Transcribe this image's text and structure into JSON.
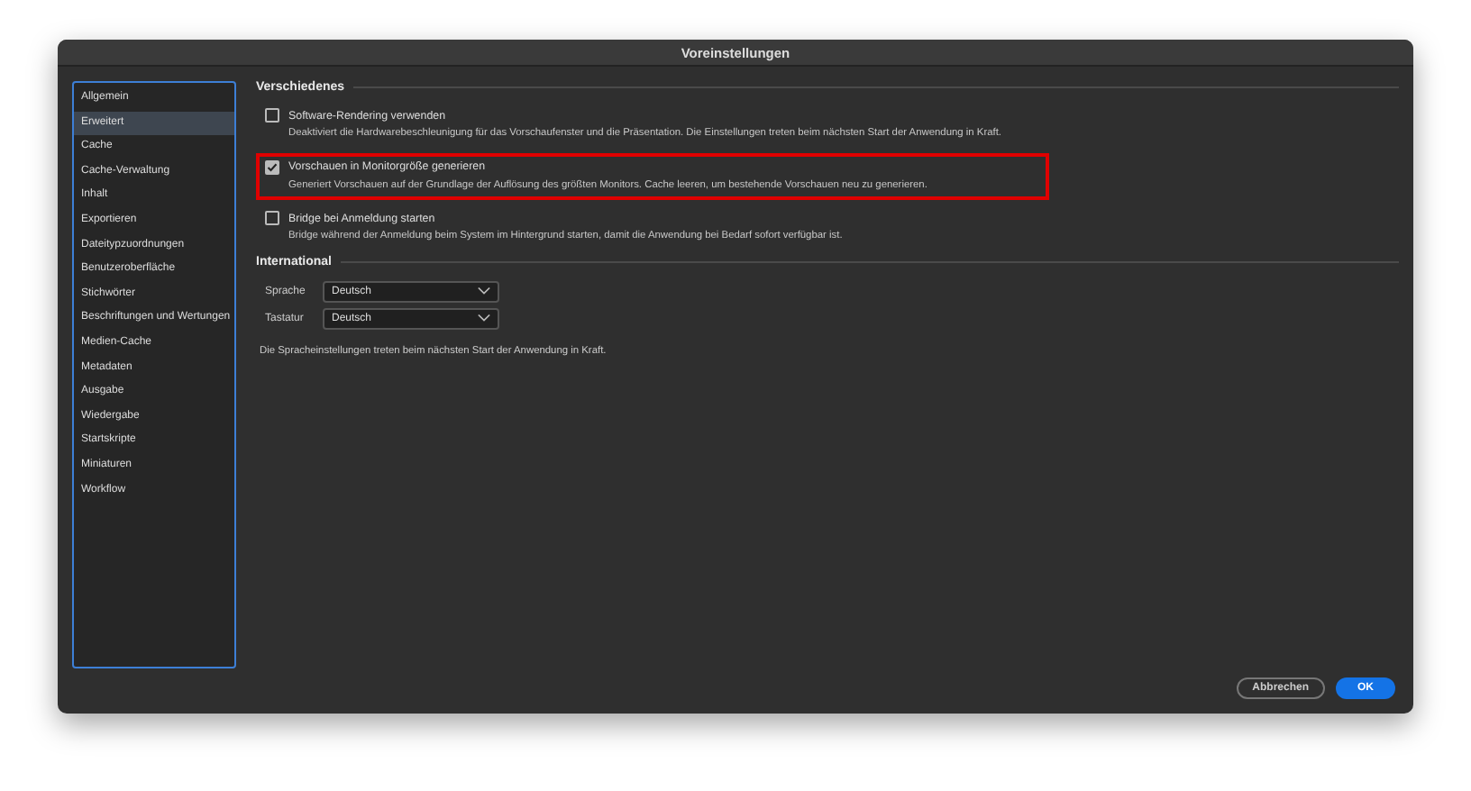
{
  "window": {
    "title": "Voreinstellungen"
  },
  "sidebar": {
    "items": [
      {
        "label": "Allgemein",
        "selected": false
      },
      {
        "label": "Erweitert",
        "selected": true
      },
      {
        "label": "Cache",
        "selected": false
      },
      {
        "label": "Cache-Verwaltung",
        "selected": false
      },
      {
        "label": "Inhalt",
        "selected": false
      },
      {
        "label": "Exportieren",
        "selected": false
      },
      {
        "label": "Dateitypzuordnungen",
        "selected": false
      },
      {
        "label": "Benutzeroberfläche",
        "selected": false
      },
      {
        "label": "Stichwörter",
        "selected": false
      },
      {
        "label": "Beschriftungen und Wertungen",
        "selected": false
      },
      {
        "label": "Medien-Cache",
        "selected": false
      },
      {
        "label": "Metadaten",
        "selected": false
      },
      {
        "label": "Ausgabe",
        "selected": false
      },
      {
        "label": "Wiedergabe",
        "selected": false
      },
      {
        "label": "Startskripte",
        "selected": false
      },
      {
        "label": "Miniaturen",
        "selected": false
      },
      {
        "label": "Workflow",
        "selected": false
      }
    ]
  },
  "sections": [
    {
      "title": "Verschiedenes",
      "options": [
        {
          "label": "Software-Rendering verwenden",
          "checked": false,
          "highlighted": false,
          "description": "Deaktiviert die Hardwarebeschleunigung für das Vorschaufenster und die Präsentation. Die Einstellungen treten beim nächsten Start der Anwendung in Kraft."
        },
        {
          "label": "Vorschauen in Monitorgröße generieren",
          "checked": true,
          "highlighted": true,
          "description": "Generiert Vorschauen auf der Grundlage der Auflösung des größten Monitors.  Cache leeren, um bestehende Vorschauen neu zu generieren."
        },
        {
          "label": "Bridge bei Anmeldung starten",
          "checked": false,
          "highlighted": false,
          "description": "Bridge während der Anmeldung beim System im Hintergrund starten, damit die Anwendung bei Bedarf sofort verfügbar ist."
        }
      ]
    },
    {
      "title": "International",
      "fields": [
        {
          "label": "Sprache",
          "value": "Deutsch"
        },
        {
          "label": "Tastatur",
          "value": "Deutsch"
        }
      ],
      "note": "Die Spracheinstellungen treten beim nächsten Start der Anwendung in Kraft."
    }
  ],
  "buttons": [
    {
      "label": "Abbrechen",
      "kind": "secondary"
    },
    {
      "label": "OK",
      "kind": "primary"
    }
  ]
}
